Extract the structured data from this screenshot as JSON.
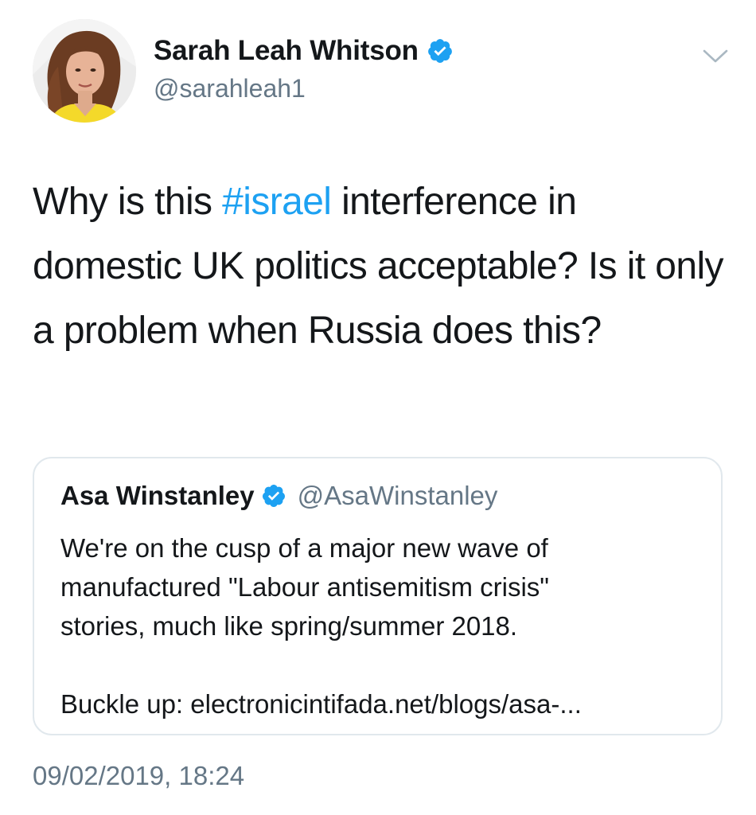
{
  "author": {
    "display_name": "Sarah Leah Whitson",
    "handle": "@sarahleah1",
    "verified": true,
    "avatar_icon": "profile-photo"
  },
  "tweet": {
    "text_before": "Why is this ",
    "hashtag": "#israel",
    "text_after": " interference in domestic UK politics acceptable? Is it only a problem when Russia does this?"
  },
  "quoted_tweet": {
    "display_name": "Asa Winstanley",
    "handle": "@AsaWinstanley",
    "verified": true,
    "lines": [
      "We're on the cusp of a major new wave of",
      "manufactured \"Labour antisemitism crisis\"",
      "stories, much like spring/summer 2018."
    ],
    "link_line": "Buckle up: electronicintifada.net/blogs/asa-..."
  },
  "timestamp": "09/02/2019, 18:24",
  "colors": {
    "hashtag": "#1da1f2",
    "verified_badge": "#1da1f2",
    "secondary_text": "#657786",
    "border": "#e1e8ed"
  },
  "icons": {
    "verified": "verified-badge-icon",
    "menu": "chevron-down-icon"
  }
}
